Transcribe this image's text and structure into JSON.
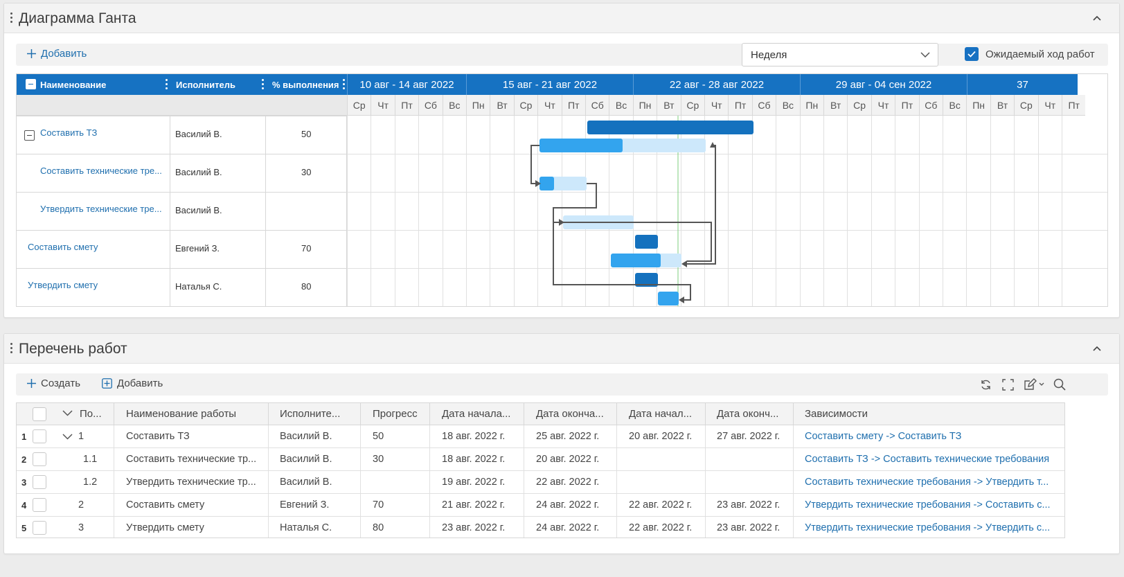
{
  "gantt_panel": {
    "title": "Диаграмма Ганта",
    "add_label": "Добавить",
    "scale_select": "Неделя",
    "expected_label": "Ожидаемый ход работ",
    "expected_checked": true,
    "columns": [
      "Наименование",
      "Исполнитель",
      "% выполнения"
    ],
    "weeks": [
      "10 авг - 14 авг 2022",
      "15 авг - 21 авг 2022",
      "22 авг - 28 авг 2022",
      "29 авг - 04 сен 2022",
      "37"
    ],
    "days": [
      "Ср",
      "Чт",
      "Пт",
      "Сб",
      "Вс",
      "Пн",
      "Вт",
      "Ср",
      "Чт",
      "Пт",
      "Сб",
      "Вс",
      "Пн",
      "Вт",
      "Ср",
      "Чт",
      "Пт",
      "Сб",
      "Вс",
      "Пн",
      "Вт",
      "Ср",
      "Чт",
      "Пт",
      "Сб",
      "Вс",
      "Пн",
      "Вт",
      "Ср",
      "Чт",
      "Пт"
    ],
    "rows": [
      {
        "name": "Составить ТЗ",
        "performer": "Василий В.",
        "percent": "50"
      },
      {
        "name": "Составить технические тре...",
        "performer": "Василий В.",
        "percent": "30"
      },
      {
        "name": "Утвердить технические тре...",
        "performer": "Василий В.",
        "percent": ""
      },
      {
        "name": "Составить смету",
        "performer": "Евгений З.",
        "percent": "70"
      },
      {
        "name": "Утвердить смету",
        "performer": "Наталья С.",
        "percent": "80"
      }
    ],
    "colors": {
      "header": "#1672c2",
      "bar_dark": "#1471be",
      "bar": "#33a4ee",
      "bar_light": "#cde8fb",
      "today": "#7ccf7c"
    }
  },
  "works_panel": {
    "title": "Перечень работ",
    "create_label": "Создать",
    "add_label": "Добавить",
    "toolbar_icons": [
      "refresh-icon",
      "fullscreen-icon",
      "edit-icon",
      "search-icon"
    ],
    "columns": [
      "По...",
      "Наименование работы",
      "Исполните...",
      "Прогресс",
      "Дата начала...",
      "Дата оконча...",
      "Дата начал...",
      "Дата оконч...",
      "Зависимости"
    ],
    "rows": [
      {
        "num": "1",
        "pos": "1",
        "name": "Составить ТЗ",
        "performer": "Василий В.",
        "progress": "50",
        "start": "18 авг. 2022 г.",
        "end": "25 авг. 2022 г.",
        "start2": "20 авг. 2022 г.",
        "end2": "27 авг. 2022 г.",
        "deps": "Составить смету -> Составить ТЗ"
      },
      {
        "num": "2",
        "pos": "1.1",
        "name": "Составить технические тр...",
        "performer": "Василий В.",
        "progress": "30",
        "start": "18 авг. 2022 г.",
        "end": "20 авг. 2022 г.",
        "start2": "",
        "end2": "",
        "deps": "Составить ТЗ -> Составить технические требования"
      },
      {
        "num": "3",
        "pos": "1.2",
        "name": "Утвердить технические тр...",
        "performer": "Василий В.",
        "progress": "",
        "start": "19 авг. 2022 г.",
        "end": "22 авг. 2022 г.",
        "start2": "",
        "end2": "",
        "deps": "Составить технические требования -> Утвердить т..."
      },
      {
        "num": "4",
        "pos": "2",
        "name": "Составить смету",
        "performer": "Евгений З.",
        "progress": "70",
        "start": "21 авг. 2022 г.",
        "end": "24 авг. 2022 г.",
        "start2": "22 авг. 2022 г.",
        "end2": "23 авг. 2022 г.",
        "deps": "Утвердить технические требования -> Составить с..."
      },
      {
        "num": "5",
        "pos": "3",
        "name": "Утвердить смету",
        "performer": "Наталья С.",
        "progress": "80",
        "start": "23 авг. 2022 г.",
        "end": "24 авг. 2022 г.",
        "start2": "22 авг. 2022 г.",
        "end2": "23 авг. 2022 г.",
        "deps": "Утвердить технические требования -> Утвердить с..."
      }
    ]
  }
}
